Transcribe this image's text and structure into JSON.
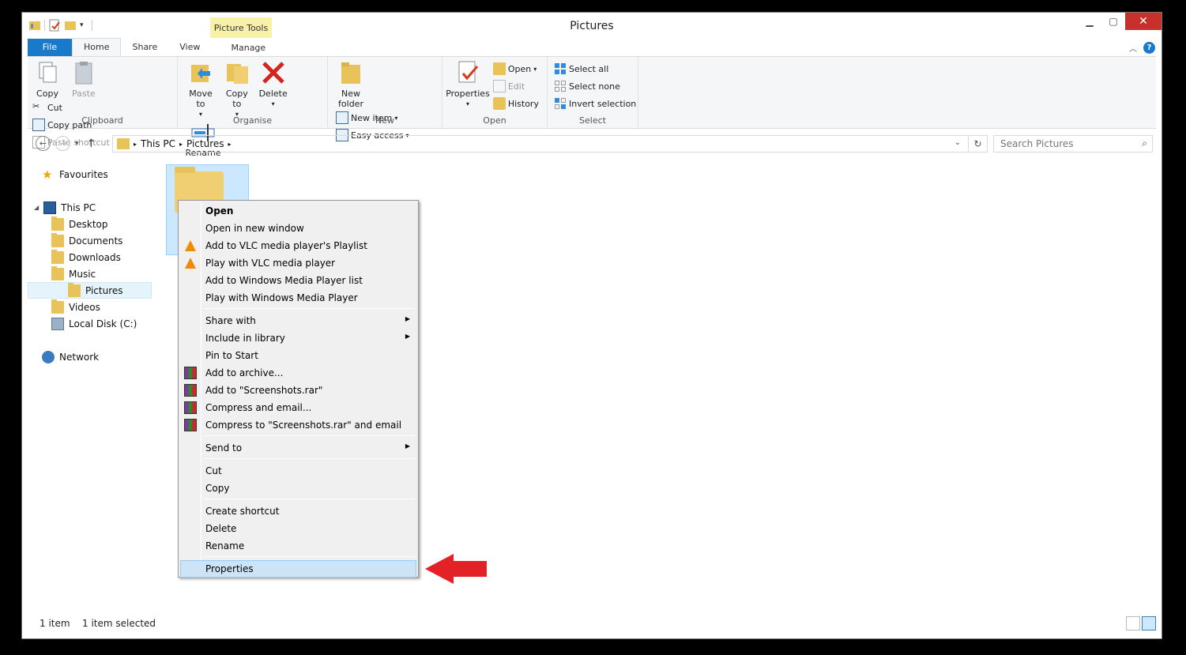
{
  "window": {
    "title": "Pictures",
    "context_tab_group": "Picture Tools",
    "caption_buttons": [
      "minimize-icon",
      "maximize-icon",
      "close-icon"
    ]
  },
  "ribbon": {
    "tabs": [
      "File",
      "Home",
      "Share",
      "View",
      "Manage"
    ],
    "groups": {
      "clipboard": {
        "label": "Clipboard",
        "copy": "Copy",
        "paste": "Paste",
        "cut": "Cut",
        "copy_path": "Copy path",
        "paste_shortcut": "Paste shortcut"
      },
      "organise": {
        "label": "Organise",
        "move_to": "Move to",
        "copy_to": "Copy to",
        "delete": "Delete",
        "rename": "Rename"
      },
      "new": {
        "label": "New",
        "new_folder": "New folder",
        "new_item": "New item",
        "easy_access": "Easy access"
      },
      "open": {
        "label": "Open",
        "properties": "Properties",
        "open": "Open",
        "edit": "Edit",
        "history": "History"
      },
      "select": {
        "label": "Select",
        "select_all": "Select all",
        "select_none": "Select none",
        "invert_selection": "Invert selection"
      }
    }
  },
  "address": {
    "crumbs": [
      "This PC",
      "Pictures"
    ],
    "search_placeholder": "Search Pictures"
  },
  "navpane": {
    "favourites": "Favourites",
    "this_pc": "This PC",
    "items": [
      "Desktop",
      "Documents",
      "Downloads",
      "Music",
      "Pictures",
      "Videos",
      "Local Disk (C:)"
    ],
    "network": "Network",
    "selected": "Pictures"
  },
  "status": {
    "count": "1 item",
    "selected": "1 item selected"
  },
  "context_menu": {
    "items": [
      {
        "label": "Open"
      },
      {
        "label": "Open in new window"
      },
      {
        "label": "Add to VLC media player's Playlist"
      },
      {
        "label": "Play with VLC media player"
      },
      {
        "label": "Add to Windows Media Player list"
      },
      {
        "label": "Play with Windows Media Player"
      },
      {
        "label": "Share with"
      },
      {
        "label": "Include in library"
      },
      {
        "label": "Pin to Start"
      },
      {
        "label": "Add to archive..."
      },
      {
        "label": "Add to \"Screenshots.rar\""
      },
      {
        "label": "Compress and email..."
      },
      {
        "label": "Compress to \"Screenshots.rar\" and email"
      },
      {
        "label": "Send to"
      },
      {
        "label": "Cut"
      },
      {
        "label": "Copy"
      },
      {
        "label": "Create shortcut"
      },
      {
        "label": "Delete"
      },
      {
        "label": "Rename"
      },
      {
        "label": "Properties"
      }
    ],
    "highlighted": "Properties"
  },
  "annotation": {
    "arrow_color": "#e32227"
  }
}
